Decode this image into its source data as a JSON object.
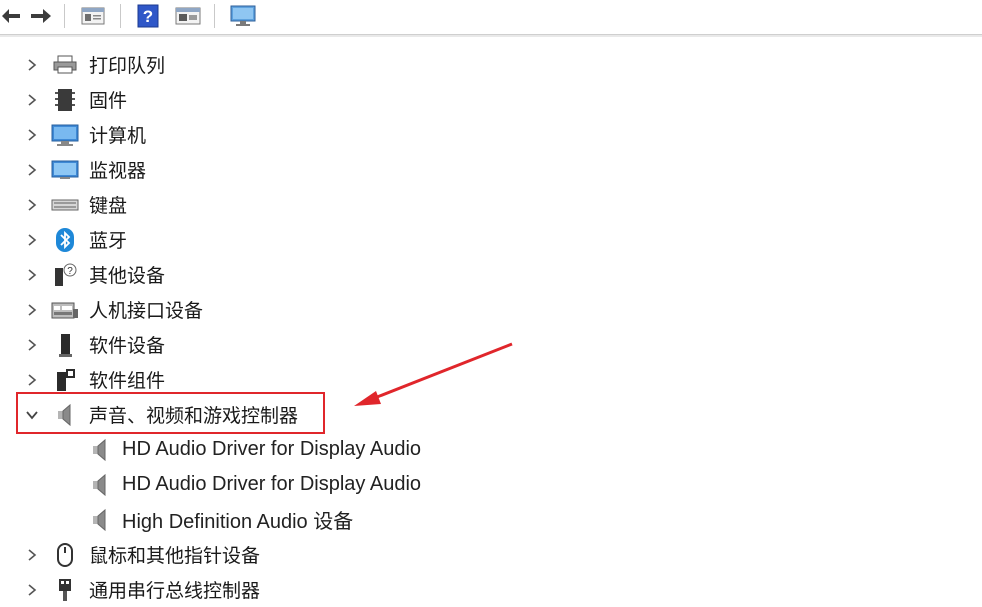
{
  "colors": {
    "highlight": "#e0262b",
    "arrow": "#e0262b",
    "icon_blue": "#1e88d8",
    "icon_dark": "#333333"
  },
  "toolbar": {
    "buttons": [
      {
        "name": "back-arrow-icon"
      },
      {
        "name": "forward-arrow-icon"
      },
      {
        "name": "properties-icon"
      },
      {
        "name": "help-icon"
      },
      {
        "name": "update-driver-icon"
      },
      {
        "name": "monitor-icon"
      }
    ]
  },
  "tree": {
    "categories_top": [
      {
        "label": "打印队列",
        "icon": "printer-icon",
        "state": "collapsed"
      },
      {
        "label": "固件",
        "icon": "firmware-icon",
        "state": "collapsed"
      },
      {
        "label": "计算机",
        "icon": "computer-icon",
        "state": "collapsed"
      },
      {
        "label": "监视器",
        "icon": "monitor-icon",
        "state": "collapsed"
      },
      {
        "label": "键盘",
        "icon": "keyboard-icon",
        "state": "collapsed"
      },
      {
        "label": "蓝牙",
        "icon": "bluetooth-icon",
        "state": "collapsed"
      },
      {
        "label": "其他设备",
        "icon": "unknown-device-icon",
        "state": "collapsed"
      },
      {
        "label": "人机接口设备",
        "icon": "hid-icon",
        "state": "collapsed"
      },
      {
        "label": "软件设备",
        "icon": "software-device-icon",
        "state": "collapsed"
      },
      {
        "label": "软件组件",
        "icon": "software-component-icon",
        "state": "collapsed"
      }
    ],
    "expanded_category": {
      "label": "声音、视频和游戏控制器",
      "icon": "speaker-icon",
      "state": "expanded"
    },
    "children": [
      {
        "label": "HD Audio Driver for Display Audio",
        "icon": "speaker-icon"
      },
      {
        "label": "HD Audio Driver for Display Audio",
        "icon": "speaker-icon"
      },
      {
        "label": "High Definition Audio 设备",
        "icon": "speaker-icon"
      }
    ],
    "categories_bottom": [
      {
        "label": "鼠标和其他指针设备",
        "icon": "mouse-icon",
        "state": "collapsed"
      },
      {
        "label": "通用串行总线控制器",
        "icon": "usb-icon",
        "state": "collapsed"
      }
    ]
  }
}
